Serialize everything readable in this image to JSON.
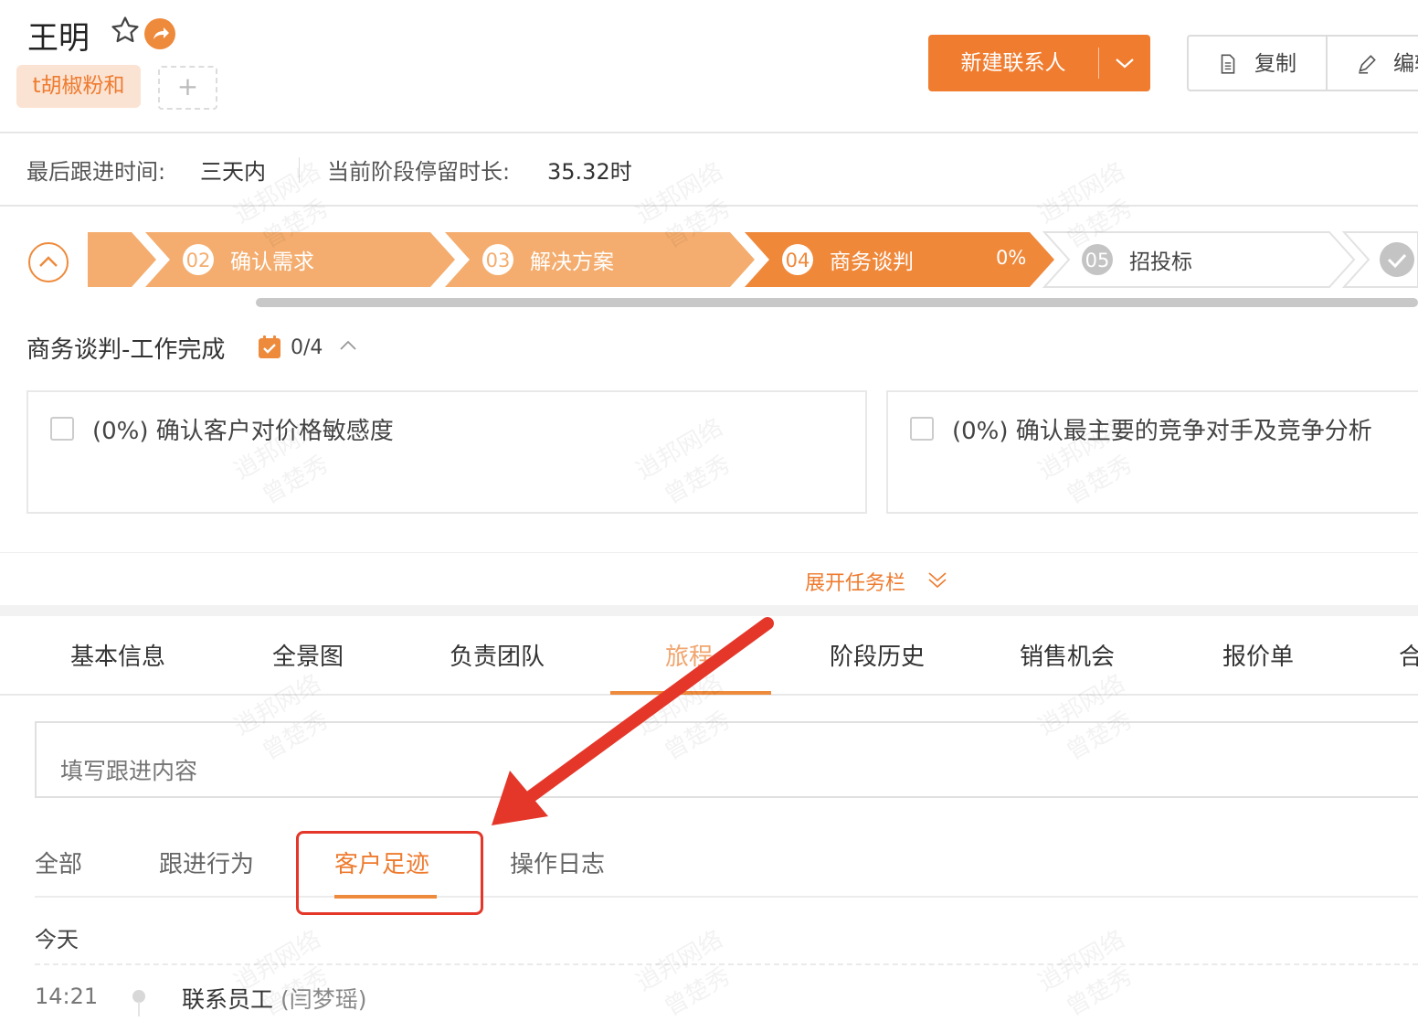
{
  "header": {
    "name": "王明",
    "tag": "t胡椒粉和",
    "add_tag": "+",
    "new_contact": "新建联系人",
    "copy": "复制",
    "edit": "编辑"
  },
  "info": {
    "last_follow_label": "最后跟进时间:",
    "last_follow_value": "三天内",
    "stay_label": "当前阶段停留时长:",
    "stay_value": "35.32时"
  },
  "stages": [
    {
      "num": "02",
      "label": "确认需求"
    },
    {
      "num": "03",
      "label": "解决方案"
    },
    {
      "num": "04",
      "label": "商务谈判",
      "percent": "0%"
    },
    {
      "num": "05",
      "label": "招投标"
    }
  ],
  "tasks": {
    "title": "商务谈判-工作完成",
    "count": "0/4",
    "items": [
      {
        "text": "(0%)  确认客户对价格敏感度"
      },
      {
        "text": "(0%)  确认最主要的竞争对手及竞争分析"
      }
    ],
    "expand": "展开任务栏"
  },
  "tabs": [
    "基本信息",
    "全景图",
    "负责团队",
    "旅程",
    "阶段历史",
    "销售机会",
    "报价单",
    "合同"
  ],
  "active_tab": "旅程",
  "follow_input": {
    "placeholder": "填写跟进内容"
  },
  "subtabs": [
    "全部",
    "跟进行为",
    "客户足迹",
    "操作日志"
  ],
  "active_subtab": "客户足迹",
  "timeline": {
    "day": "今天",
    "entries": [
      {
        "time": "14:21",
        "action": "联系员工",
        "person": "(闫梦瑶)"
      }
    ]
  },
  "watermark": {
    "line1": "逍邦网络",
    "line2": "曾楚秀"
  },
  "colors": {
    "accent": "#f07c2f",
    "accent_light": "#f4ad6e",
    "annotation_red": "#e4372a"
  }
}
